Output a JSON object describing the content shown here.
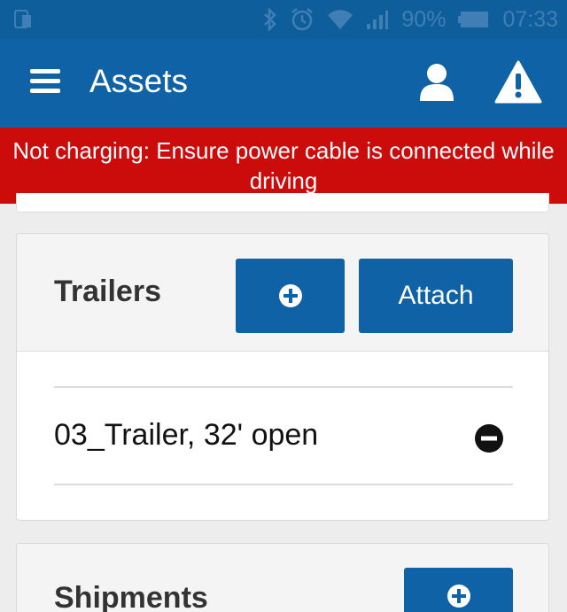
{
  "status_bar": {
    "battery": "90%",
    "time": "07:33",
    "icons": [
      "phone-screen-icon",
      "bluetooth-icon",
      "alarm-icon",
      "wifi-icon",
      "signal-icon",
      "battery-icon"
    ]
  },
  "app_bar": {
    "title": "Assets",
    "icons": [
      "hamburger-menu-icon",
      "user-profile-icon",
      "warning-icon"
    ],
    "color": "#0e62a5"
  },
  "banner": {
    "message": "Not charging: Ensure power cable is connected while driving",
    "color": "#cc0b0b"
  },
  "trailers": {
    "title": "Trailers",
    "attach_label": "Attach",
    "items": [
      {
        "name": "03_Trailer, 32' open"
      }
    ]
  },
  "shipments": {
    "title": "Shipments"
  }
}
